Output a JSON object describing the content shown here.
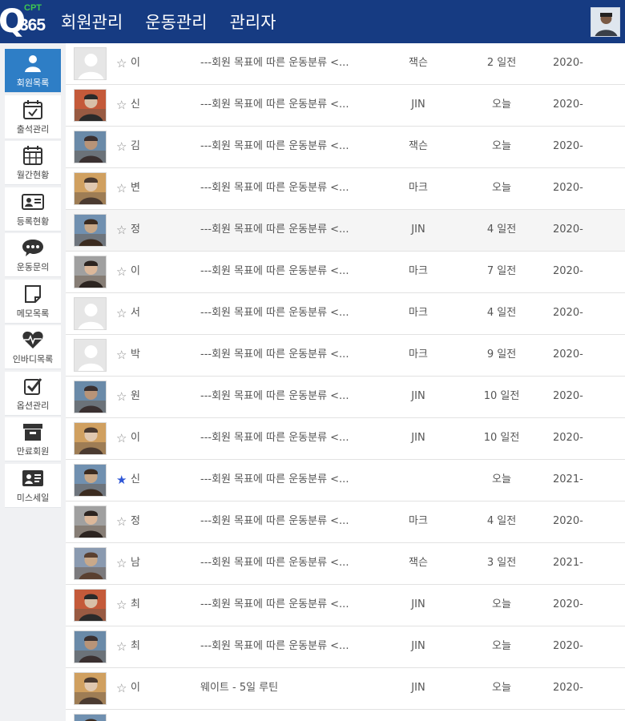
{
  "header": {
    "logo_top": "CPT",
    "logo_q": "Q",
    "logo_num": "365",
    "nav": [
      "회원관리",
      "운동관리",
      "관리자"
    ]
  },
  "sidebar": {
    "items": [
      {
        "label": "회원목록",
        "icon": "user-icon",
        "active": true
      },
      {
        "label": "출석관리",
        "icon": "calendar-check-icon",
        "active": false
      },
      {
        "label": "월간현황",
        "icon": "calendar-grid-icon",
        "active": false
      },
      {
        "label": "등록현황",
        "icon": "id-card-icon",
        "active": false
      },
      {
        "label": "운동문의",
        "icon": "chat-icon",
        "active": false
      },
      {
        "label": "메모목록",
        "icon": "memo-icon",
        "active": false
      },
      {
        "label": "인바디목록",
        "icon": "heart-pulse-icon",
        "active": false
      },
      {
        "label": "옵션관리",
        "icon": "checkbox-icon",
        "active": false
      },
      {
        "label": "만료회원",
        "icon": "archive-icon",
        "active": false
      },
      {
        "label": "미스세일",
        "icon": "contact-card-icon",
        "active": false
      }
    ]
  },
  "rows": [
    {
      "name": "이",
      "starred": false,
      "title": "---회원 목표에 따른 운동분류 <...",
      "trainer": "잭슨",
      "ago": "2 일전",
      "date": "2020-",
      "photo": "blank",
      "highlight": false
    },
    {
      "name": "신",
      "starred": false,
      "title": "---회원 목표에 따른 운동분류 <...",
      "trainer": "JIN",
      "ago": "오늘",
      "date": "2020-",
      "photo": "photo",
      "highlight": false
    },
    {
      "name": "김",
      "starred": false,
      "title": "---회원 목표에 따른 운동분류 <...",
      "trainer": "잭슨",
      "ago": "오늘",
      "date": "2020-",
      "photo": "photo",
      "highlight": false
    },
    {
      "name": "변",
      "starred": false,
      "title": "---회원 목표에 따른 운동분류 <...",
      "trainer": "마크",
      "ago": "오늘",
      "date": "2020-",
      "photo": "photo",
      "highlight": false
    },
    {
      "name": "정",
      "starred": false,
      "title": "---회원 목표에 따른 운동분류 <...",
      "trainer": "JIN",
      "ago": "4 일전",
      "date": "2020-",
      "photo": "photo",
      "highlight": true
    },
    {
      "name": "이",
      "starred": false,
      "title": "---회원 목표에 따른 운동분류 <...",
      "trainer": "마크",
      "ago": "7 일전",
      "date": "2020-",
      "photo": "photo",
      "highlight": false
    },
    {
      "name": "서",
      "starred": false,
      "title": "---회원 목표에 따른 운동분류 <...",
      "trainer": "마크",
      "ago": "4 일전",
      "date": "2020-",
      "photo": "blank",
      "highlight": false
    },
    {
      "name": "박",
      "starred": false,
      "title": "---회원 목표에 따른 운동분류 <...",
      "trainer": "마크",
      "ago": "9 일전",
      "date": "2020-",
      "photo": "blank",
      "highlight": false
    },
    {
      "name": "원",
      "starred": false,
      "title": "---회원 목표에 따른 운동분류 <...",
      "trainer": "JIN",
      "ago": "10 일전",
      "date": "2020-",
      "photo": "photo",
      "highlight": false
    },
    {
      "name": "이",
      "starred": false,
      "title": "---회원 목표에 따른 운동분류 <...",
      "trainer": "JIN",
      "ago": "10 일전",
      "date": "2020-",
      "photo": "photo",
      "highlight": false
    },
    {
      "name": "신",
      "starred": true,
      "title": "---회원 목표에 따른 운동분류 <...",
      "trainer": "",
      "ago": "오늘",
      "date": "2021-",
      "photo": "photo",
      "highlight": false
    },
    {
      "name": "정",
      "starred": false,
      "title": "---회원 목표에 따른 운동분류 <...",
      "trainer": "마크",
      "ago": "4 일전",
      "date": "2020-",
      "photo": "photo",
      "highlight": false
    },
    {
      "name": "남",
      "starred": false,
      "title": "---회원 목표에 따른 운동분류 <...",
      "trainer": "잭슨",
      "ago": "3 일전",
      "date": "2021-",
      "photo": "photo",
      "highlight": false
    },
    {
      "name": "최",
      "starred": false,
      "title": "---회원 목표에 따른 운동분류 <...",
      "trainer": "JIN",
      "ago": "오늘",
      "date": "2020-",
      "photo": "photo",
      "highlight": false
    },
    {
      "name": "최",
      "starred": false,
      "title": "---회원 목표에 따른 운동분류 <...",
      "trainer": "JIN",
      "ago": "오늘",
      "date": "2020-",
      "photo": "photo",
      "highlight": false
    },
    {
      "name": "이",
      "starred": false,
      "title": "웨이트 - 5일 루틴",
      "trainer": "JIN",
      "ago": "오늘",
      "date": "2020-",
      "photo": "photo",
      "highlight": false
    },
    {
      "name": "",
      "starred": false,
      "title": "",
      "trainer": "",
      "ago": "",
      "date": "",
      "photo": "photo",
      "highlight": false
    }
  ],
  "colors": {
    "header_bg": "#163b82",
    "active_bg": "#2e7ec6",
    "star_on": "#2f57d6",
    "logo_accent": "#3ec850"
  }
}
